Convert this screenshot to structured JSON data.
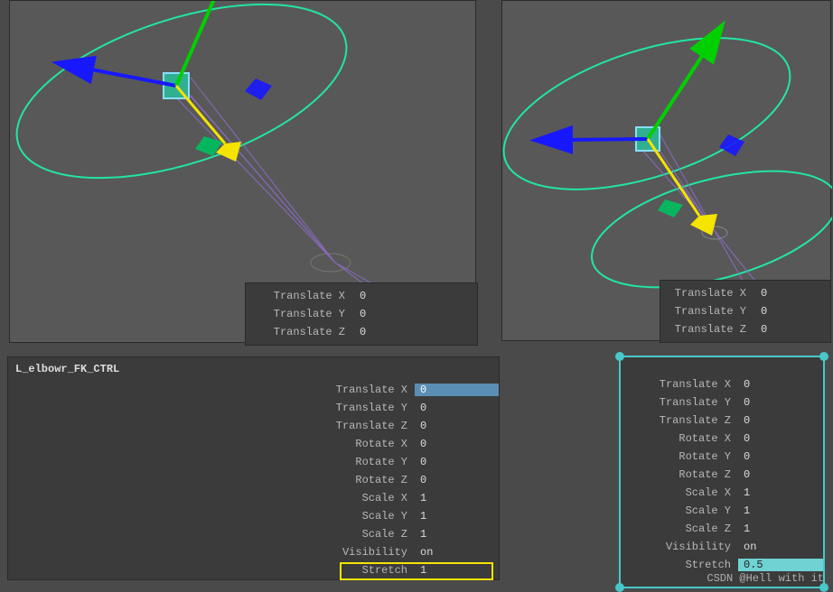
{
  "watermark": "CSDN @Hell with it",
  "panel_left": {
    "title": "L_elbowr_FK_CTRL",
    "rows": [
      {
        "label": "Translate X",
        "value": "0",
        "sel": "blue"
      },
      {
        "label": "Translate Y",
        "value": "0"
      },
      {
        "label": "Translate Z",
        "value": "0"
      },
      {
        "label": "Rotate X",
        "value": "0"
      },
      {
        "label": "Rotate Y",
        "value": "0"
      },
      {
        "label": "Rotate Z",
        "value": "0"
      },
      {
        "label": "Scale X",
        "value": "1"
      },
      {
        "label": "Scale Y",
        "value": "1"
      },
      {
        "label": "Scale Z",
        "value": "1"
      },
      {
        "label": "Visibility",
        "value": "on"
      },
      {
        "label": "Stretch",
        "value": "1"
      }
    ]
  },
  "panel_right": {
    "rows": [
      {
        "label": "Translate X",
        "value": "0"
      },
      {
        "label": "Translate Y",
        "value": "0"
      },
      {
        "label": "Translate Z",
        "value": "0"
      },
      {
        "label": "Rotate X",
        "value": "0"
      },
      {
        "label": "Rotate Y",
        "value": "0"
      },
      {
        "label": "Rotate Z",
        "value": "0"
      },
      {
        "label": "Scale X",
        "value": "1"
      },
      {
        "label": "Scale Y",
        "value": "1"
      },
      {
        "label": "Scale Z",
        "value": "1"
      },
      {
        "label": "Visibility",
        "value": "on"
      },
      {
        "label": "Stretch",
        "value": "0.5",
        "sel": "cyan"
      }
    ]
  },
  "hud_left": {
    "rows": [
      {
        "label": "Translate X",
        "value": "0"
      },
      {
        "label": "Translate Y",
        "value": "0"
      },
      {
        "label": "Translate Z",
        "value": "0"
      }
    ]
  },
  "hud_right": {
    "rows": [
      {
        "label": "Translate X",
        "value": "0"
      },
      {
        "label": "Translate Y",
        "value": "0"
      },
      {
        "label": "Translate Z",
        "value": "0"
      }
    ]
  }
}
